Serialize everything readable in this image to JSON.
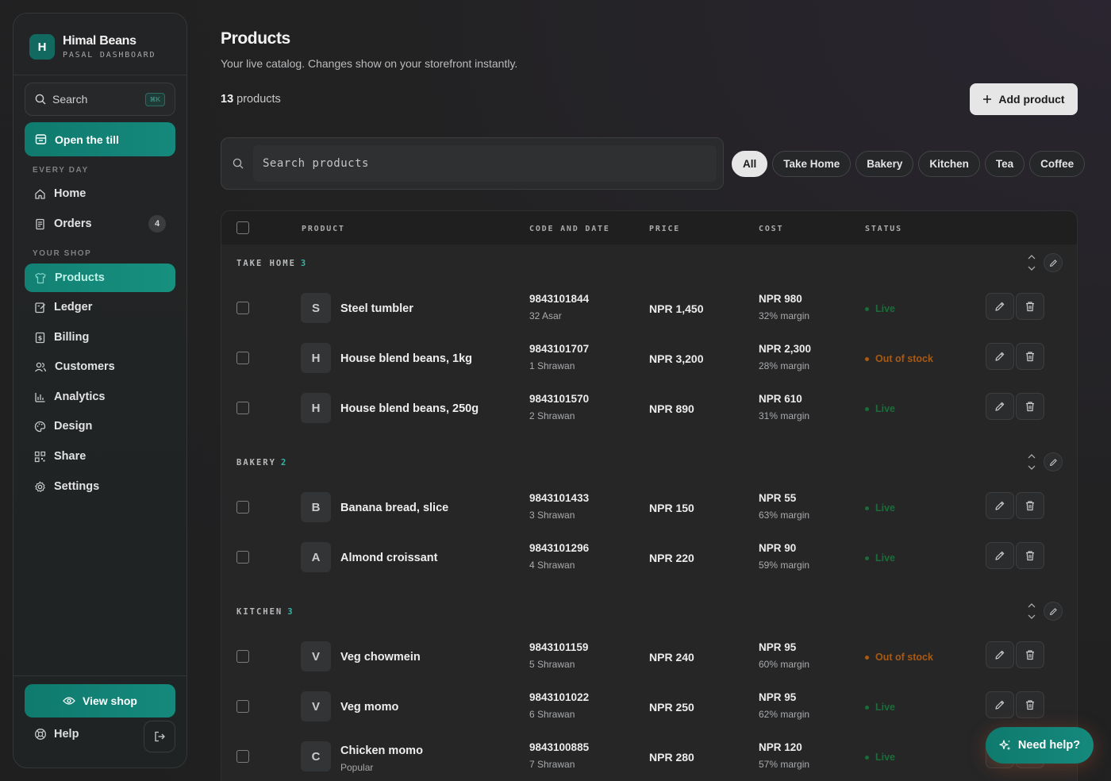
{
  "brand": {
    "initial": "H",
    "name": "Himal Beans",
    "subtitle": "PASAL DASHBOARD"
  },
  "sidebar": {
    "search_label": "Search",
    "search_shortcut": "⌘K",
    "till_label": "Open the till",
    "section_every_day": "EVERY DAY",
    "section_your_shop": "YOUR SHOP",
    "items": [
      {
        "label": "Home",
        "icon": "home-icon"
      },
      {
        "label": "Orders",
        "icon": "receipt-icon",
        "count": "4"
      },
      {
        "label": "Products",
        "icon": "shirt-icon",
        "active": true
      },
      {
        "label": "Ledger",
        "icon": "ledger-icon"
      },
      {
        "label": "Billing",
        "icon": "bill-icon"
      },
      {
        "label": "Customers",
        "icon": "users-icon"
      },
      {
        "label": "Analytics",
        "icon": "chart-icon"
      },
      {
        "label": "Design",
        "icon": "palette-icon"
      },
      {
        "label": "Share",
        "icon": "qr-icon"
      },
      {
        "label": "Settings",
        "icon": "gear-icon"
      }
    ],
    "view_shop_label": "View shop",
    "help_label": "Help"
  },
  "header": {
    "title": "Products",
    "subtitle": "Your live catalog. Changes show on your storefront instantly.",
    "count": "13",
    "count_suffix": " products",
    "add_label": "Add product"
  },
  "search": {
    "placeholder": "Search products"
  },
  "filters": [
    "All",
    "Take Home",
    "Bakery",
    "Kitchen",
    "Tea",
    "Coffee"
  ],
  "table": {
    "columns": [
      "PRODUCT",
      "CODE AND DATE",
      "PRICE",
      "COST",
      "STATUS"
    ],
    "groups": [
      {
        "name": "TAKE HOME",
        "count": "3",
        "rows": [
          {
            "initial": "S",
            "name": "Steel tumbler",
            "sub": "",
            "code": "9843101844",
            "date": "32 Asar",
            "price": "NPR 1,450",
            "cost": "NPR 980",
            "margin": "32% margin",
            "status": "Live",
            "status_kind": "live"
          },
          {
            "initial": "H",
            "name": "House blend beans, 1kg",
            "sub": "",
            "code": "9843101707",
            "date": "1 Shrawan",
            "price": "NPR 3,200",
            "cost": "NPR 2,300",
            "margin": "28% margin",
            "status": "Out of stock",
            "status_kind": "out"
          },
          {
            "initial": "H",
            "name": "House blend beans, 250g",
            "sub": "",
            "code": "9843101570",
            "date": "2 Shrawan",
            "price": "NPR 890",
            "cost": "NPR 610",
            "margin": "31% margin",
            "status": "Live",
            "status_kind": "live"
          }
        ]
      },
      {
        "name": "BAKERY",
        "count": "2",
        "rows": [
          {
            "initial": "B",
            "name": "Banana bread, slice",
            "sub": "",
            "code": "9843101433",
            "date": "3 Shrawan",
            "price": "NPR 150",
            "cost": "NPR 55",
            "margin": "63% margin",
            "status": "Live",
            "status_kind": "live"
          },
          {
            "initial": "A",
            "name": "Almond croissant",
            "sub": "",
            "code": "9843101296",
            "date": "4 Shrawan",
            "price": "NPR 220",
            "cost": "NPR 90",
            "margin": "59% margin",
            "status": "Live",
            "status_kind": "live"
          }
        ]
      },
      {
        "name": "KITCHEN",
        "count": "3",
        "rows": [
          {
            "initial": "V",
            "name": "Veg chowmein",
            "sub": "",
            "code": "9843101159",
            "date": "5 Shrawan",
            "price": "NPR 240",
            "cost": "NPR 95",
            "margin": "60% margin",
            "status": "Out of stock",
            "status_kind": "out"
          },
          {
            "initial": "V",
            "name": "Veg momo",
            "sub": "",
            "code": "9843101022",
            "date": "6 Shrawan",
            "price": "NPR 250",
            "cost": "NPR 95",
            "margin": "62% margin",
            "status": "Live",
            "status_kind": "live"
          },
          {
            "initial": "C",
            "name": "Chicken momo",
            "sub": "Popular",
            "code": "9843100885",
            "date": "7 Shrawan",
            "price": "NPR 280",
            "cost": "NPR 120",
            "margin": "57% margin",
            "status": "Live",
            "status_kind": "live"
          }
        ]
      }
    ]
  },
  "need_help_label": "Need help?",
  "colors": {
    "accent": "#15897c",
    "live": "#1d6b3a",
    "out_of_stock": "#a85a14"
  }
}
